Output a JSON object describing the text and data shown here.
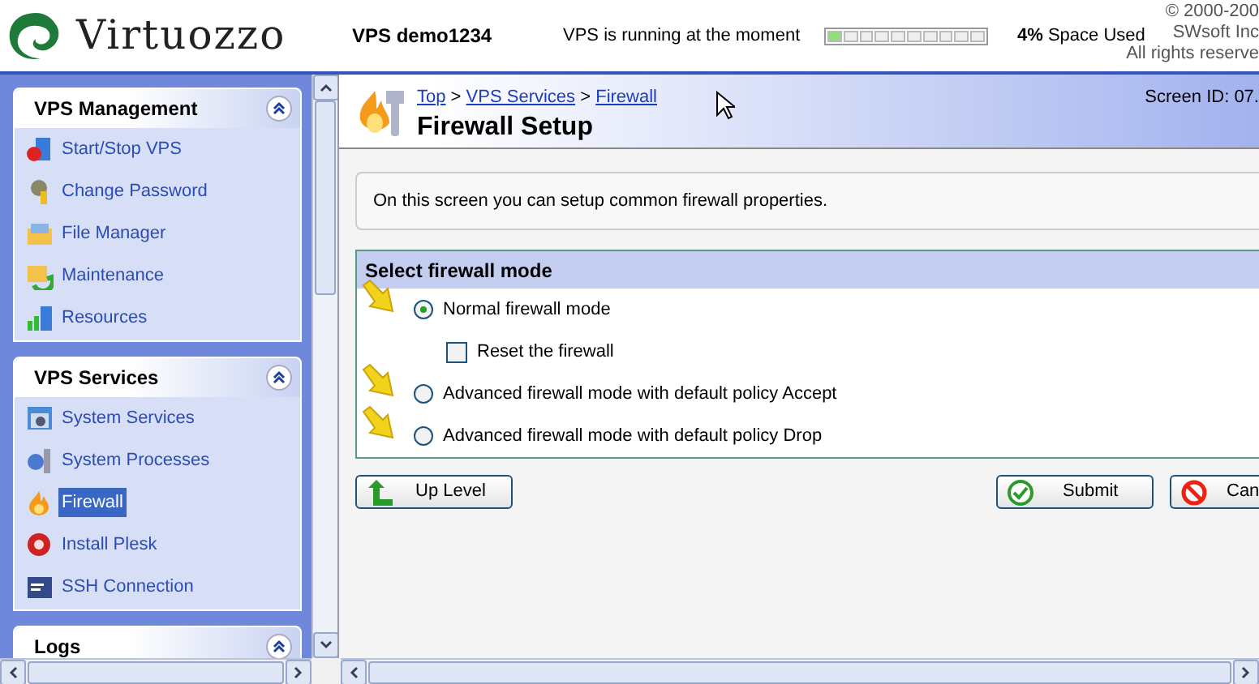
{
  "header": {
    "logo": "Virtuozzo",
    "vps_name": "VPS demo1234",
    "vps_status": "VPS is running at the moment",
    "space": {
      "level": 0.04,
      "percent": "4%",
      "label": "Space Used"
    },
    "copyright": [
      "© 2000-200",
      "SWsoft Inc",
      "All rights reserve"
    ]
  },
  "sidebar": {
    "sections": [
      {
        "title": "VPS Management",
        "expanded": true,
        "items": [
          {
            "label": "Start/Stop VPS",
            "selected": false
          },
          {
            "label": "Change Password",
            "selected": false
          },
          {
            "label": "File Manager",
            "selected": false
          },
          {
            "label": "Maintenance",
            "selected": false
          },
          {
            "label": "Resources",
            "selected": false
          }
        ]
      },
      {
        "title": "VPS Services",
        "expanded": true,
        "items": [
          {
            "label": "System Services",
            "selected": false
          },
          {
            "label": "System Processes",
            "selected": false
          },
          {
            "label": "Firewall",
            "selected": true
          },
          {
            "label": "Install Plesk",
            "selected": false
          },
          {
            "label": "SSH Connection",
            "selected": false
          }
        ]
      },
      {
        "title": "Logs",
        "expanded": true
      }
    ]
  },
  "page": {
    "breadcrumb": [
      "Top",
      "VPS Services",
      "Firewall"
    ],
    "breadcrumb_separator": ">",
    "title": "Firewall Setup",
    "screen_id": "Screen ID: 07.",
    "info": "On this screen you can setup common firewall properties.",
    "mode_panel": {
      "title": "Select firewall mode",
      "options": [
        {
          "kind": "radio",
          "label": "Normal firewall mode",
          "selected": true
        },
        {
          "kind": "checkbox",
          "label": "Reset the firewall",
          "checked": false
        },
        {
          "kind": "radio",
          "label": "Advanced firewall mode with default policy Accept",
          "selected": false
        },
        {
          "kind": "radio",
          "label": "Advanced firewall mode with default policy Drop",
          "selected": false
        }
      ]
    },
    "buttons": [
      {
        "kind": "up",
        "label": "Up Level"
      },
      {
        "kind": "submit",
        "label": "Submit"
      },
      {
        "kind": "cancel",
        "label": "Can"
      }
    ]
  }
}
